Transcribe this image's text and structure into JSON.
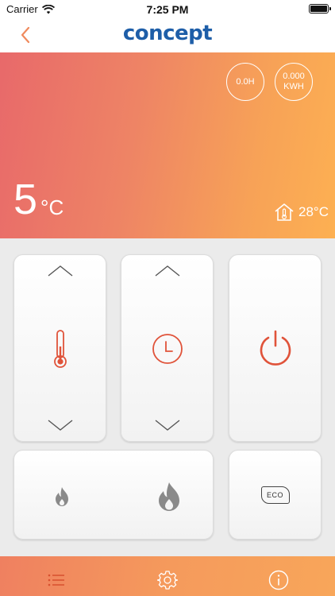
{
  "status_bar": {
    "carrier": "Carrier",
    "time": "7:25 PM"
  },
  "nav": {
    "logo_text": "concept"
  },
  "hero": {
    "hours_value": "0.0H",
    "energy_value": "0.000",
    "energy_unit": "KWH",
    "set_temperature": "5",
    "set_temperature_unit": "°C",
    "room_temperature": "28°C"
  },
  "controls": {
    "eco_label": "ECO"
  },
  "colors": {
    "accent": "#e0533a",
    "brand_blue": "#1e5ea8",
    "gradient_start": "#e8696a",
    "gradient_end": "#fdb052",
    "chevron": "#555555",
    "flame": "#8a8a8a"
  },
  "icons": {
    "back": "chevron-left-icon",
    "temperature": "thermometer-icon",
    "timer": "clock-icon",
    "power": "power-icon",
    "flame_low": "flame-small-icon",
    "flame_high": "flame-large-icon",
    "eco": "eco-icon",
    "list": "list-icon",
    "settings": "gear-icon",
    "info": "info-icon"
  }
}
